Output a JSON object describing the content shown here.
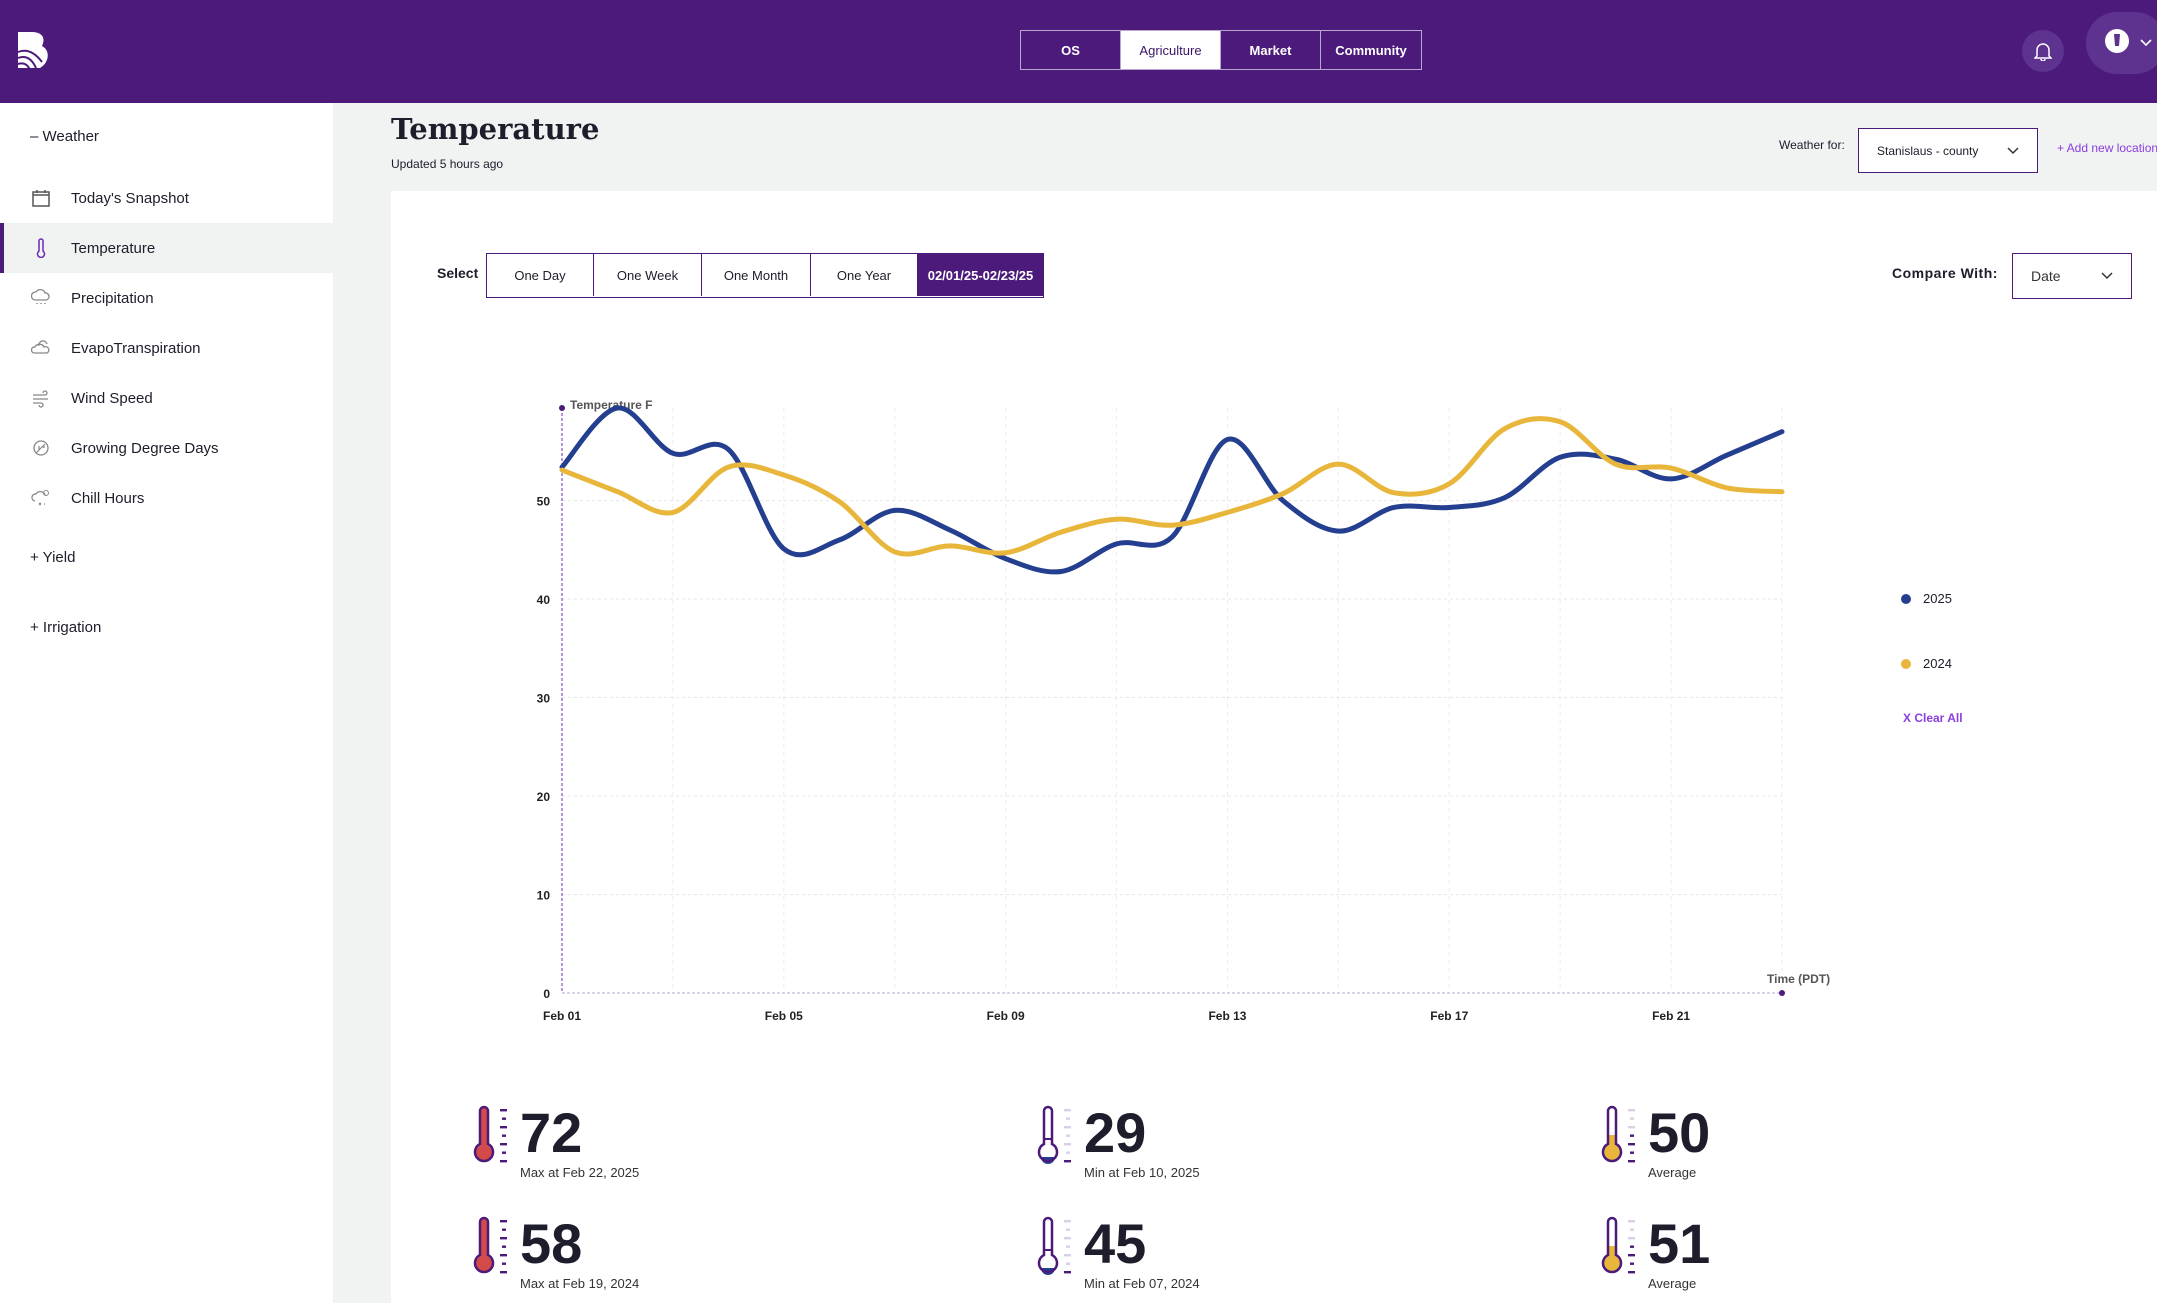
{
  "header": {
    "nav_tabs": [
      {
        "label": "OS",
        "active": false
      },
      {
        "label": "Agriculture",
        "active": true
      },
      {
        "label": "Market",
        "active": false
      },
      {
        "label": "Community",
        "active": false
      }
    ],
    "icons": [
      "logo",
      "bell-icon",
      "avatar-icon",
      "chevron-down-icon"
    ]
  },
  "sidebar": {
    "weather_section": "– Weather",
    "items": [
      {
        "label": "Today's Snapshot",
        "icon": "calendar-icon",
        "active": false
      },
      {
        "label": "Temperature",
        "icon": "thermometer-icon",
        "active": true
      },
      {
        "label": "Precipitation",
        "icon": "rain-cloud-icon",
        "active": false
      },
      {
        "label": "EvapoTranspiration",
        "icon": "cloud-sun-icon",
        "active": false
      },
      {
        "label": "Wind Speed",
        "icon": "wind-icon",
        "active": false
      },
      {
        "label": "Growing Degree Days",
        "icon": "leaf-icon",
        "active": false
      },
      {
        "label": "Chill Hours",
        "icon": "snow-cloud-icon",
        "active": false
      }
    ],
    "yield_section": "+ Yield",
    "irrigation_section": "+ Irrigation"
  },
  "page": {
    "title": "Temperature",
    "updated": "Updated 5 hours ago",
    "weather_for_label": "Weather for:",
    "location_value": "Stanislaus - county",
    "add_location": "+ Add new location",
    "select_label": "Select",
    "ranges": [
      {
        "label": "One Day",
        "active": false
      },
      {
        "label": "One Week",
        "active": false
      },
      {
        "label": "One Month",
        "active": false
      },
      {
        "label": "One Year",
        "active": false
      },
      {
        "label": "02/01/25-02/23/25",
        "active": true
      }
    ],
    "compare_label": "Compare With:",
    "compare_value": "Date",
    "clear_all": "X Clear All"
  },
  "colors": {
    "brand": "#4b1a7a",
    "accent": "#8a3ee0",
    "series_2025": "#243f8f",
    "series_2024": "#e8b63a",
    "max": "#d44a4a"
  },
  "chart_data": {
    "type": "line",
    "ylabel": "Temperature F",
    "xlabel": "Time (PDT)",
    "ylim": [
      0,
      59.4
    ],
    "yticks": [
      0,
      10,
      20,
      30,
      40,
      50
    ],
    "grid": true,
    "legend_placement": "right",
    "x": [
      "Feb 01",
      "Feb 02",
      "Feb 03",
      "Feb 04",
      "Feb 05",
      "Feb 06",
      "Feb 07",
      "Feb 08",
      "Feb 09",
      "Feb 10",
      "Feb 11",
      "Feb 12",
      "Feb 13",
      "Feb 14",
      "Feb 15",
      "Feb 16",
      "Feb 17",
      "Feb 18",
      "Feb 19",
      "Feb 20",
      "Feb 21",
      "Feb 22",
      "Feb 23"
    ],
    "xtick_labels": [
      "Feb 01",
      "Feb 05",
      "Feb 09",
      "Feb 13",
      "Feb 17",
      "Feb 21"
    ],
    "series": [
      {
        "name": "2025",
        "color": "#243f8f",
        "values": [
          53.4,
          59.4,
          54.8,
          55.2,
          45.1,
          46.0,
          49.0,
          47.0,
          44.1,
          42.8,
          45.6,
          46.3,
          56.2,
          50.0,
          46.9,
          49.3,
          49.3,
          50.3,
          54.4,
          54.2,
          52.2,
          54.6,
          57.0
        ]
      },
      {
        "name": "2024",
        "color": "#e8b63a",
        "values": [
          53.1,
          50.9,
          48.8,
          53.4,
          52.6,
          49.9,
          44.8,
          45.4,
          44.7,
          46.8,
          48.1,
          47.5,
          48.8,
          50.7,
          53.7,
          50.8,
          51.7,
          57.3,
          58.0,
          53.7,
          53.3,
          51.3,
          50.9
        ]
      }
    ]
  },
  "stats": [
    {
      "value": "72",
      "label": "Max at Feb 22, 2025",
      "kind": "max"
    },
    {
      "value": "29",
      "label": "Min at Feb 10, 2025",
      "kind": "min"
    },
    {
      "value": "50",
      "label": "Average",
      "kind": "avg"
    },
    {
      "value": "58",
      "label": "Max at Feb 19, 2024",
      "kind": "max"
    },
    {
      "value": "45",
      "label": "Min at Feb 07, 2024",
      "kind": "min"
    },
    {
      "value": "51",
      "label": "Average",
      "kind": "avg"
    }
  ]
}
